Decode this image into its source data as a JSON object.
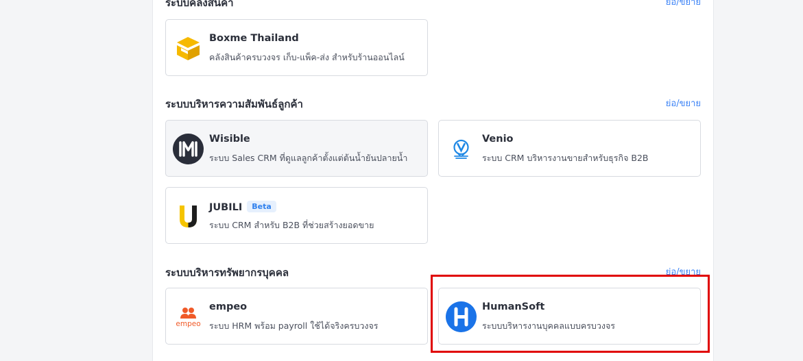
{
  "sections": [
    {
      "title": "ระบบคลังสินค้า",
      "toggle": "ย่อ/ขยาย",
      "cards": [
        {
          "name": "Boxme Thailand",
          "desc": "คลังสินค้าครบวงจร เก็บ-แพ็ค-ส่ง สำหรับร้านออนไลน์",
          "icon": "boxme-logo-icon"
        }
      ]
    },
    {
      "title": "ระบบบริหารความสัมพันธ์ลูกค้า",
      "toggle": "ย่อ/ขยาย",
      "cards": [
        {
          "name": "Wisible",
          "desc": "ระบบ Sales CRM ที่ดูแลลูกค้าตั้งแต่ต้นน้ำยันปลายน้ำ",
          "icon": "wisible-logo-icon"
        },
        {
          "name": "Venio",
          "desc": "ระบบ CRM บริหารงานขายสำหรับธุรกิจ B2B",
          "icon": "venio-logo-icon"
        },
        {
          "name": "JUBILI",
          "badge": "Beta",
          "desc": "ระบบ CRM สำหรับ B2B ที่ช่วยสร้างยอดขาย",
          "icon": "jubili-logo-icon"
        }
      ]
    },
    {
      "title": "ระบบบริหารทรัพยากรบุคคล",
      "toggle": "ย่อ/ขยาย",
      "cards": [
        {
          "name": "empeo",
          "desc": "ระบบ HRM พร้อม payroll ใช้ได้จริงครบวงจร",
          "icon": "empeo-logo-icon",
          "logo_text": "empeo"
        },
        {
          "name": "HumanSoft",
          "desc": "ระบบบริหารงานบุคคลแบบครบวงจร",
          "icon": "humansoft-logo-icon"
        }
      ]
    }
  ],
  "colors": {
    "accent_link": "#3b82f6",
    "highlight": "#e00000",
    "boxme": "#f6b900",
    "wisible": "#2a2e3a",
    "venio": "#1e88e5",
    "jubili": "#f5c400",
    "empeo": "#f05a28",
    "humansoft": "#1a73e8"
  }
}
